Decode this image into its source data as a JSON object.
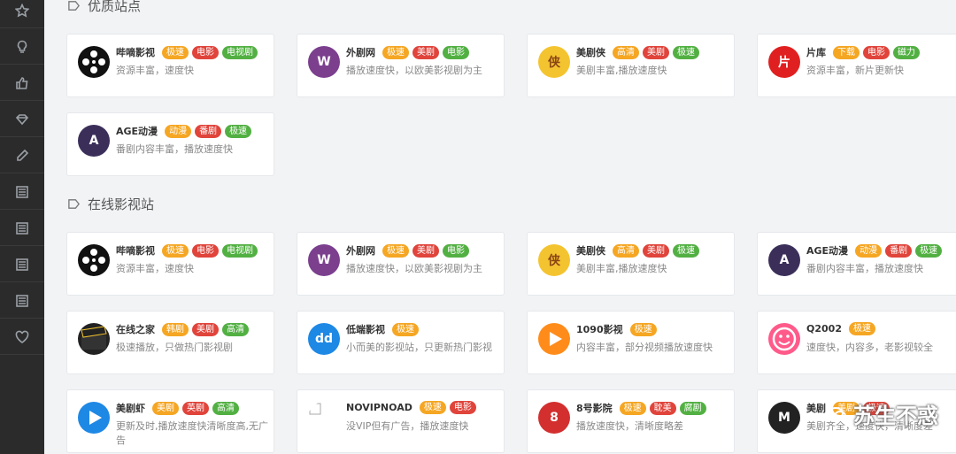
{
  "sidebar": {
    "icons": [
      "star-icon",
      "lightbulb-icon",
      "thumbs-up-icon",
      "diamond-icon",
      "pencil-icon",
      "list-icon",
      "list-icon",
      "list-icon",
      "list-icon",
      "heart-icon"
    ]
  },
  "sections": [
    {
      "title": "优质站点",
      "cards": [
        {
          "name": "哔嘀影视",
          "tags": [
            {
              "t": "极速",
              "c": "#f5a623"
            },
            {
              "t": "电影",
              "c": "#e0443b"
            },
            {
              "t": "电视剧",
              "c": "#52b043"
            }
          ],
          "desc": "资源丰富，速度快",
          "logo": "film-reel",
          "logo_bg": "#111"
        },
        {
          "name": "外剧网",
          "tags": [
            {
              "t": "极速",
              "c": "#f5a623"
            },
            {
              "t": "美剧",
              "c": "#e0443b"
            },
            {
              "t": "电影",
              "c": "#52b043"
            }
          ],
          "desc": "播放速度快，以欧美影视剧为主",
          "logo": "W",
          "logo_bg": "#7b3f8e"
        },
        {
          "name": "美剧侠",
          "tags": [
            {
              "t": "高清",
              "c": "#f5a623"
            },
            {
              "t": "美剧",
              "c": "#e0443b"
            },
            {
              "t": "极速",
              "c": "#52b043"
            }
          ],
          "desc": "美剧丰富,播放速度快",
          "logo": "侠",
          "logo_bg": "#f4c430"
        },
        {
          "name": "片库",
          "tags": [
            {
              "t": "下载",
              "c": "#f5a623"
            },
            {
              "t": "电影",
              "c": "#e0443b"
            },
            {
              "t": "磁力",
              "c": "#52b043"
            }
          ],
          "desc": "资源丰富，新片更新快",
          "logo": "片",
          "logo_bg": "#e02020"
        },
        {
          "name": "AGE动漫",
          "tags": [
            {
              "t": "动漫",
              "c": "#f5a623"
            },
            {
              "t": "番剧",
              "c": "#e0443b"
            },
            {
              "t": "极速",
              "c": "#52b043"
            }
          ],
          "desc": "番剧内容丰富，播放速度快",
          "logo": "A",
          "logo_bg": "#3b2f5a"
        }
      ]
    },
    {
      "title": "在线影视站",
      "cards": [
        {
          "name": "哔嘀影视",
          "tags": [
            {
              "t": "极速",
              "c": "#f5a623"
            },
            {
              "t": "电影",
              "c": "#e0443b"
            },
            {
              "t": "电视剧",
              "c": "#52b043"
            }
          ],
          "desc": "资源丰富，速度快",
          "logo": "film-reel",
          "logo_bg": "#111"
        },
        {
          "name": "外剧网",
          "tags": [
            {
              "t": "极速",
              "c": "#f5a623"
            },
            {
              "t": "美剧",
              "c": "#e0443b"
            },
            {
              "t": "电影",
              "c": "#52b043"
            }
          ],
          "desc": "播放速度快，以欧美影视剧为主",
          "logo": "W",
          "logo_bg": "#7b3f8e"
        },
        {
          "name": "美剧侠",
          "tags": [
            {
              "t": "高清",
              "c": "#f5a623"
            },
            {
              "t": "美剧",
              "c": "#e0443b"
            },
            {
              "t": "极速",
              "c": "#52b043"
            }
          ],
          "desc": "美剧丰富,播放速度快",
          "logo": "侠",
          "logo_bg": "#f4c430"
        },
        {
          "name": "AGE动漫",
          "tags": [
            {
              "t": "动漫",
              "c": "#f5a623"
            },
            {
              "t": "番剧",
              "c": "#e0443b"
            },
            {
              "t": "极速",
              "c": "#52b043"
            }
          ],
          "desc": "番剧内容丰富，播放速度快",
          "logo": "A",
          "logo_bg": "#3b2f5a"
        },
        {
          "name": "在线之家",
          "tags": [
            {
              "t": "韩剧",
              "c": "#f5a623"
            },
            {
              "t": "美剧",
              "c": "#e0443b"
            },
            {
              "t": "高清",
              "c": "#52b043"
            }
          ],
          "desc": "极速播放，只做热门影视剧",
          "logo": "clapper",
          "logo_bg": "#222"
        },
        {
          "name": "低端影视",
          "tags": [
            {
              "t": "极速",
              "c": "#f5a623"
            }
          ],
          "desc": "小而美的影视站，只更新热门影视",
          "logo": "dd",
          "logo_bg": "#1e88e5"
        },
        {
          "name": "1090影视",
          "tags": [
            {
              "t": "极速",
              "c": "#f5a623"
            }
          ],
          "desc": "内容丰富，部分视频播放速度快",
          "logo": "play",
          "logo_bg": "#ff8c1a"
        },
        {
          "name": "Q2002",
          "tags": [
            {
              "t": "极速",
              "c": "#f5a623"
            }
          ],
          "desc": "速度快，内容多，老影视较全",
          "logo": "smile",
          "logo_bg": "#ff5a8a"
        },
        {
          "name": "美剧虾",
          "tags": [
            {
              "t": "美剧",
              "c": "#f5a623"
            },
            {
              "t": "英剧",
              "c": "#e0443b"
            },
            {
              "t": "高清",
              "c": "#52b043"
            }
          ],
          "desc": "更新及时,播放速度快清晰度高,无广告",
          "logo": "play",
          "logo_bg": "#1e88e5"
        },
        {
          "name": "NOVIPNOAD",
          "tags": [
            {
              "t": "极速",
              "c": "#f5a623"
            },
            {
              "t": "电影",
              "c": "#e0443b"
            }
          ],
          "desc": "没VIP但有广告，播放速度快",
          "logo": "broken",
          "logo_bg": "#fff"
        },
        {
          "name": "8号影院",
          "tags": [
            {
              "t": "极速",
              "c": "#f5a623"
            },
            {
              "t": "耽美",
              "c": "#e0443b"
            },
            {
              "t": "腐剧",
              "c": "#52b043"
            }
          ],
          "desc": "播放速度快，清晰度略差",
          "logo": "8",
          "logo_bg": "#d32f2f"
        },
        {
          "name": "美剧",
          "tags": [
            {
              "t": "美剧",
              "c": "#f5a623"
            },
            {
              "t": "极速",
              "c": "#e0443b"
            }
          ],
          "desc": "美剧齐全，速度快，清晰度差",
          "logo": "M",
          "logo_bg": "#222"
        }
      ]
    }
  ],
  "watermark": "苏生不惑",
  "tag_more": "..."
}
